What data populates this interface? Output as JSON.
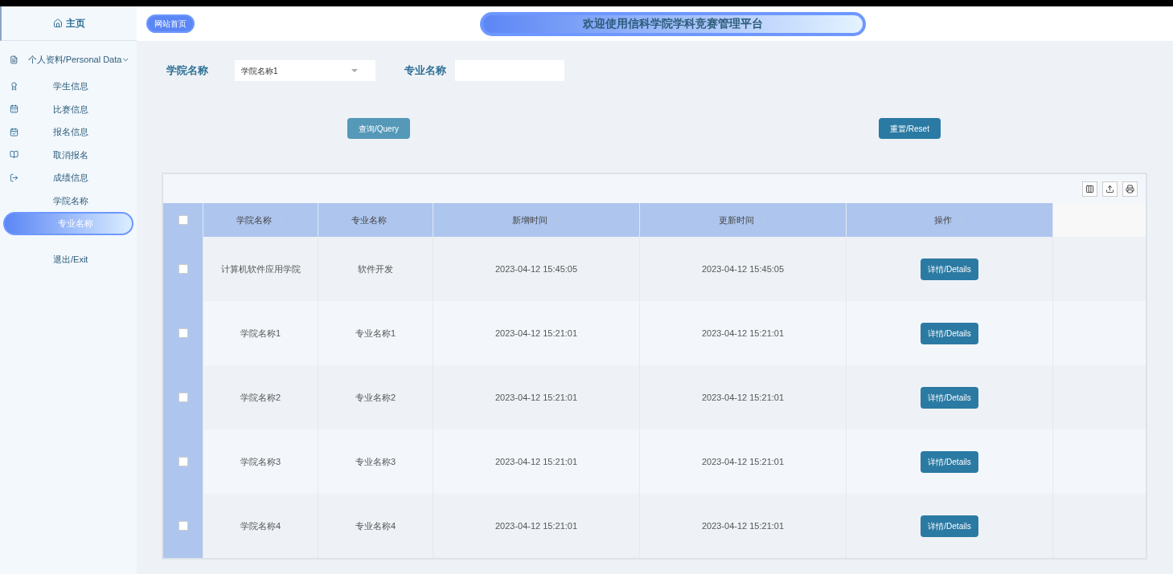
{
  "sidebar": {
    "home": "主页",
    "group": {
      "label": "个人资料/Personal Data",
      "expanded": true
    },
    "items": [
      {
        "label": "学生信息",
        "selected": false
      },
      {
        "label": "比赛信息",
        "selected": false
      },
      {
        "label": "报名信息",
        "selected": false
      },
      {
        "label": "取消报名",
        "selected": false
      },
      {
        "label": "成绩信息",
        "selected": false
      },
      {
        "label": "学院名称",
        "selected": false
      },
      {
        "label": "专业名称",
        "selected": true
      },
      {
        "label": "退出/Exit",
        "selected": false
      }
    ]
  },
  "header": {
    "site_link": "网站首页",
    "title": "欢迎使用信科学院学科竞赛管理平台"
  },
  "filters": [
    {
      "label": "学院名称",
      "kind": "select",
      "value": "学院名称1"
    },
    {
      "label": "专业名称",
      "kind": "text"
    }
  ],
  "buttons": [
    "查询/Query",
    "重置/Reset"
  ],
  "table": {
    "select_all": {
      "checked": false
    },
    "columns": [
      "学院名称",
      "专业名称",
      "新增时间",
      "更新时间",
      "操作"
    ],
    "rows": [
      {
        "checked": false,
        "cells": [
          "计算机软件应用学院",
          "软件开发",
          "2023-04-12 15:45:05",
          "2023-04-12 15:45:05"
        ],
        "action": "详情/Details"
      },
      {
        "checked": false,
        "cells": [
          "学院名称1",
          "专业名称1",
          "2023-04-12 15:21:01",
          "2023-04-12 15:21:01"
        ],
        "action": "详情/Details"
      },
      {
        "checked": false,
        "cells": [
          "学院名称2",
          "专业名称2",
          "2023-04-12 15:21:01",
          "2023-04-12 15:21:01"
        ],
        "action": "详情/Details"
      },
      {
        "checked": false,
        "cells": [
          "学院名称3",
          "专业名称3",
          "2023-04-12 15:21:01",
          "2023-04-12 15:21:01"
        ],
        "action": "详情/Details"
      },
      {
        "checked": false,
        "cells": [
          "学院名称4",
          "专业名称4",
          "2023-04-12 15:21:01",
          "2023-04-12 15:21:01"
        ],
        "action": "详情/Details"
      }
    ]
  }
}
